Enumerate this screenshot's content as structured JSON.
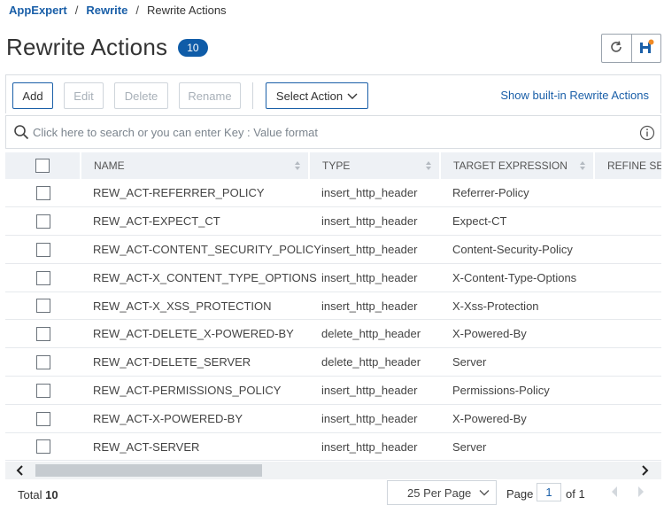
{
  "breadcrumb": {
    "root": "AppExpert",
    "section": "Rewrite",
    "current": "Rewrite Actions",
    "sep": "/"
  },
  "page": {
    "title": "Rewrite Actions",
    "count": "10"
  },
  "header_icons": [
    "refresh-icon",
    "save-config-icon"
  ],
  "toolbar": {
    "add": "Add",
    "edit": "Edit",
    "delete": "Delete",
    "rename": "Rename",
    "select_action": "Select Action",
    "builtin_link": "Show built-in Rewrite Actions"
  },
  "search": {
    "placeholder": "Click here to search or you can enter Key : Value format"
  },
  "table": {
    "columns": [
      "NAME",
      "TYPE",
      "TARGET EXPRESSION",
      "REFINE SEA"
    ],
    "rows": [
      {
        "name": "REW_ACT-REFERRER_POLICY",
        "type": "insert_http_header",
        "target": "Referrer-Policy"
      },
      {
        "name": "REW_ACT-EXPECT_CT",
        "type": "insert_http_header",
        "target": "Expect-CT"
      },
      {
        "name": "REW_ACT-CONTENT_SECURITY_POLICY",
        "type": "insert_http_header",
        "target": "Content-Security-Policy"
      },
      {
        "name": "REW_ACT-X_CONTENT_TYPE_OPTIONS",
        "type": "insert_http_header",
        "target": "X-Content-Type-Options"
      },
      {
        "name": "REW_ACT-X_XSS_PROTECTION",
        "type": "insert_http_header",
        "target": "X-Xss-Protection"
      },
      {
        "name": "REW_ACT-DELETE_X-POWERED-BY",
        "type": "delete_http_header",
        "target": "X-Powered-By"
      },
      {
        "name": "REW_ACT-DELETE_SERVER",
        "type": "delete_http_header",
        "target": "Server"
      },
      {
        "name": "REW_ACT-PERMISSIONS_POLICY",
        "type": "insert_http_header",
        "target": "Permissions-Policy"
      },
      {
        "name": "REW_ACT-X-POWERED-BY",
        "type": "insert_http_header",
        "target": "X-Powered-By"
      },
      {
        "name": "REW_ACT-SERVER",
        "type": "insert_http_header",
        "target": "Server"
      }
    ]
  },
  "footer": {
    "total_label": "Total",
    "total_value": "10",
    "per_page": "25 Per Page",
    "page_label": "Page",
    "page_value": "1",
    "of_label": "of 1"
  },
  "colors": {
    "accent": "#1a5fa8",
    "badge": "#0f5ca8",
    "header_bg": "#eef1f5",
    "save_dot": "#f08a24"
  }
}
